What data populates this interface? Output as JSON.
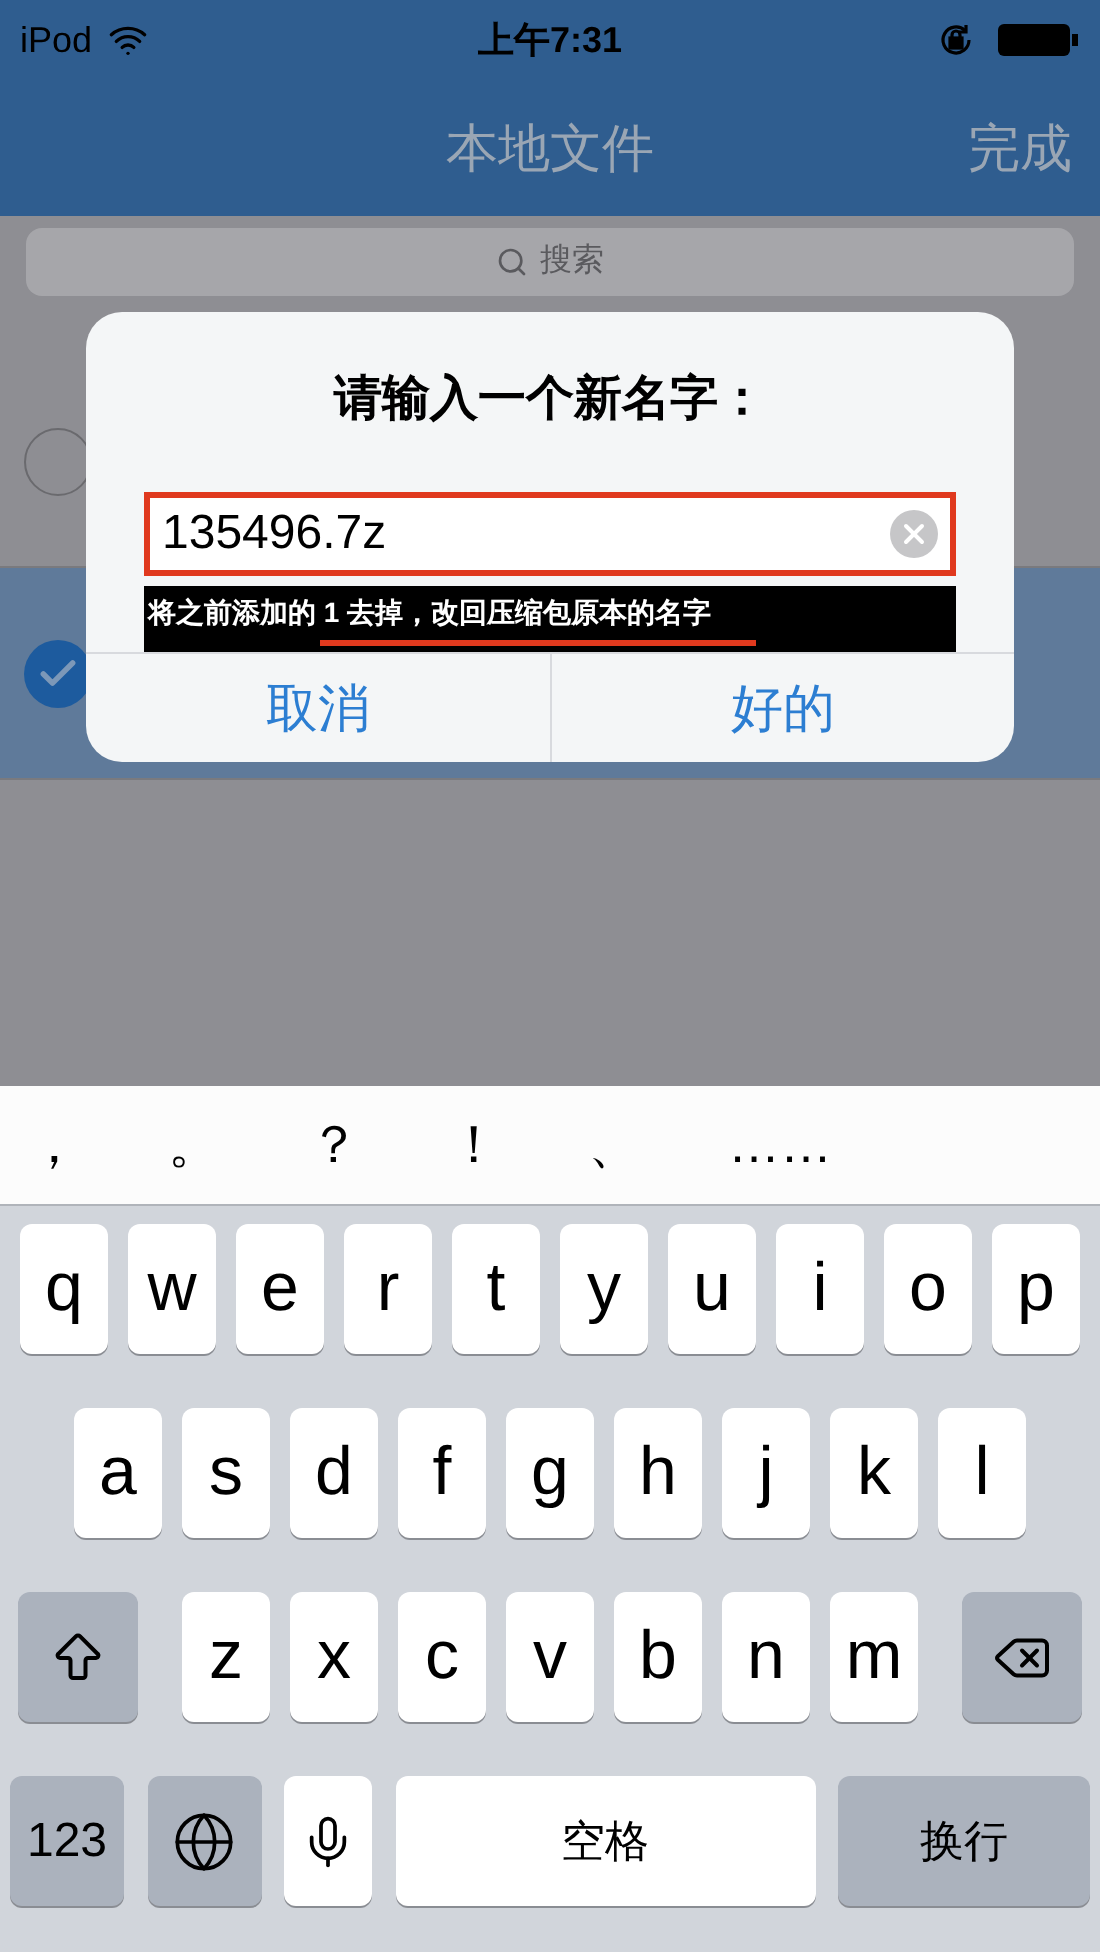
{
  "status_bar": {
    "carrier": "iPod",
    "time": "上午7:31"
  },
  "nav": {
    "title": "本地文件",
    "done": "完成"
  },
  "search": {
    "placeholder": "搜索"
  },
  "files": [
    {
      "selected": false
    },
    {
      "selected": true
    }
  ],
  "dialog": {
    "title": "请输入一个新名字：",
    "value": "135496.7z",
    "buttons": [
      {
        "label": "取消"
      },
      {
        "label": "好的"
      }
    ]
  },
  "annotation": {
    "text": "将之前添加的 1 去掉，改回压缩包原本的名字"
  },
  "keyboard": {
    "candidates": [
      "，",
      "。",
      "？",
      "！",
      "、",
      "……"
    ],
    "rows": [
      {
        "keys": [
          {
            "kind": "letter",
            "label": "q"
          },
          {
            "kind": "letter",
            "label": "w"
          },
          {
            "kind": "letter",
            "label": "e"
          },
          {
            "kind": "letter",
            "label": "r"
          },
          {
            "kind": "letter",
            "label": "t"
          },
          {
            "kind": "letter",
            "label": "y"
          },
          {
            "kind": "letter",
            "label": "u"
          },
          {
            "kind": "letter",
            "label": "i"
          },
          {
            "kind": "letter",
            "label": "o"
          },
          {
            "kind": "letter",
            "label": "p"
          }
        ]
      },
      {
        "keys": [
          {
            "kind": "letter",
            "label": "a"
          },
          {
            "kind": "letter",
            "label": "s"
          },
          {
            "kind": "letter",
            "label": "d"
          },
          {
            "kind": "letter",
            "label": "f"
          },
          {
            "kind": "letter",
            "label": "g"
          },
          {
            "kind": "letter",
            "label": "h"
          },
          {
            "kind": "letter",
            "label": "j"
          },
          {
            "kind": "letter",
            "label": "k"
          },
          {
            "kind": "letter",
            "label": "l"
          }
        ]
      },
      {
        "keys": [
          {
            "kind": "shift"
          },
          {
            "kind": "letter",
            "label": "z"
          },
          {
            "kind": "letter",
            "label": "x"
          },
          {
            "kind": "letter",
            "label": "c"
          },
          {
            "kind": "letter",
            "label": "v"
          },
          {
            "kind": "letter",
            "label": "b"
          },
          {
            "kind": "letter",
            "label": "n"
          },
          {
            "kind": "letter",
            "label": "m"
          },
          {
            "kind": "backspace"
          }
        ]
      },
      {
        "keys": [
          {
            "kind": "numbers",
            "label": "123"
          },
          {
            "kind": "globe"
          },
          {
            "kind": "mic"
          },
          {
            "kind": "space",
            "label": "空格"
          },
          {
            "kind": "return",
            "label": "换行"
          }
        ]
      }
    ]
  }
}
